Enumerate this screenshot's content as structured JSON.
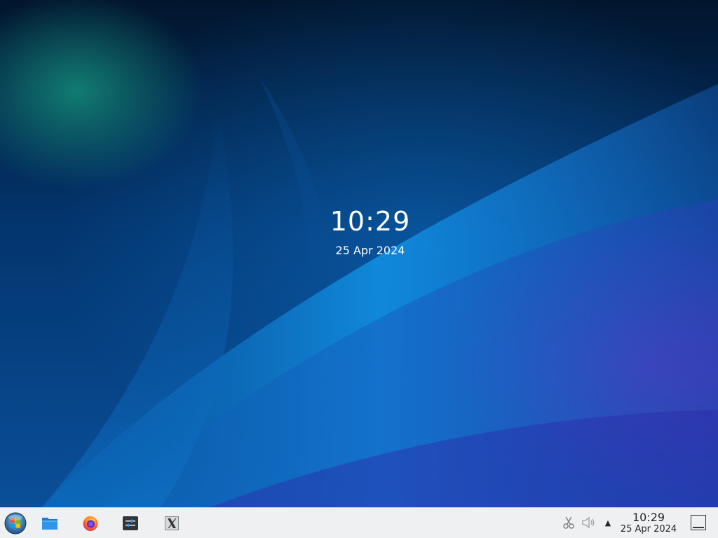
{
  "desktop": {
    "clock": {
      "time": "10:29",
      "date": "25 Apr 2024"
    }
  },
  "taskbar": {
    "launcher_icon": "start-menu-orb-icon",
    "apps": [
      {
        "name": "file-manager",
        "icon": "folder-icon"
      },
      {
        "name": "firefox",
        "icon": "firefox-icon"
      },
      {
        "name": "settings",
        "icon": "system-settings-icon"
      },
      {
        "name": "xterm",
        "icon": "x-window-icon"
      }
    ],
    "tray": {
      "expand_arrow": "▲",
      "clock": {
        "time": "10:29",
        "date": "25 Apr 2024"
      }
    }
  },
  "colors": {
    "taskbar_bg": "#eff0f1",
    "text_dark": "#232629",
    "accent_blue": "#1d99f3",
    "folder_blue": "#1d7ad6"
  }
}
